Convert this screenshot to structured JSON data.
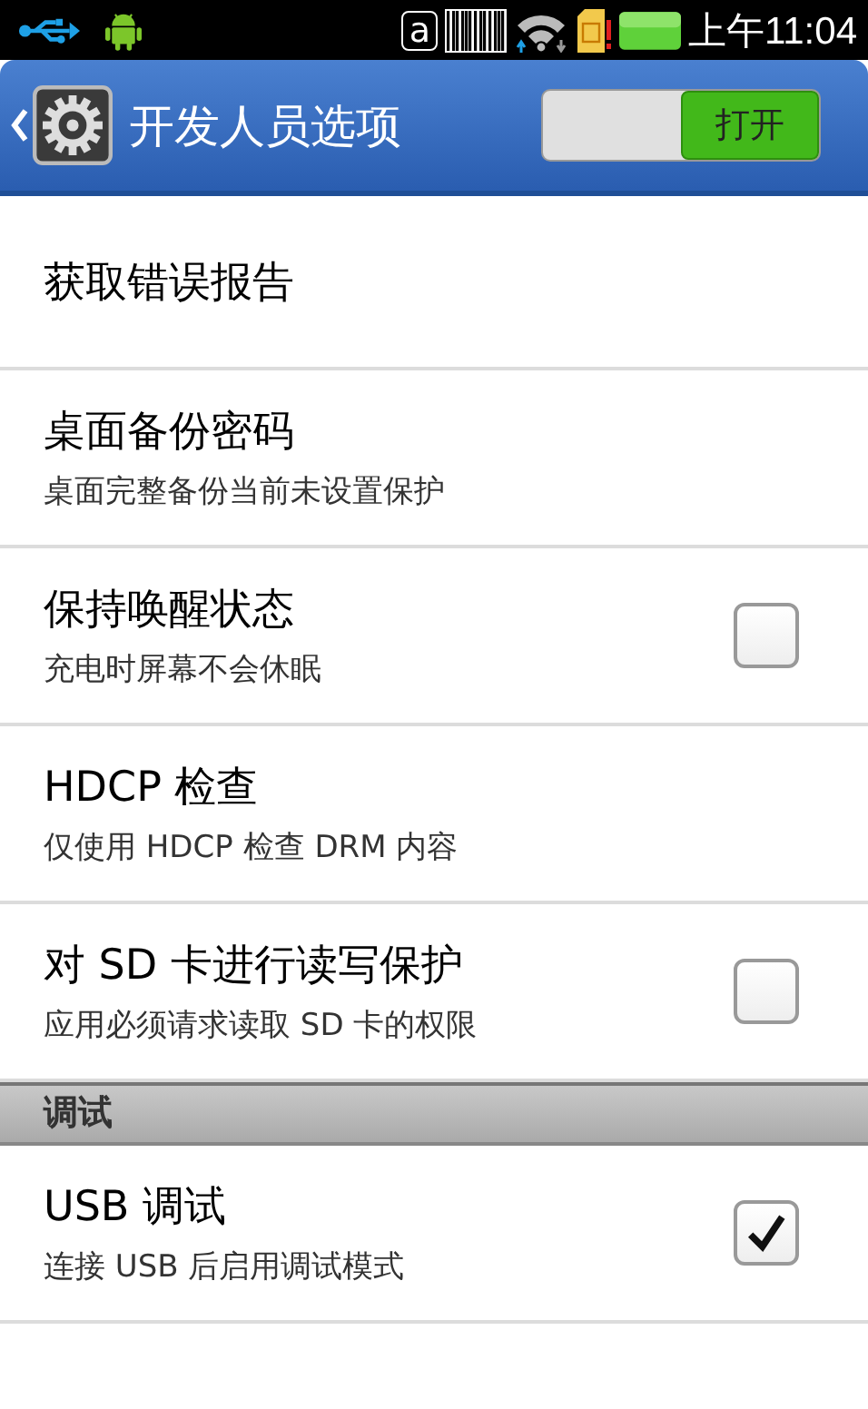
{
  "status_bar": {
    "badge": "a",
    "time": "上午11:04"
  },
  "header": {
    "title": "开发人员选项",
    "toggle": {
      "label": "打开",
      "on": true
    }
  },
  "items": [
    {
      "kind": "plain",
      "title": "获取错误报告"
    },
    {
      "kind": "plain",
      "title": "桌面备份密码",
      "summary": "桌面完整备份当前未设置保护"
    },
    {
      "kind": "checkbox",
      "title": "保持唤醒状态",
      "summary": "充电时屏幕不会休眠",
      "checked": false
    },
    {
      "kind": "plain",
      "title": "HDCP 检查",
      "summary": "仅使用 HDCP 检查 DRM 内容"
    },
    {
      "kind": "checkbox",
      "title": "对 SD 卡进行读写保护",
      "summary": "应用必须请求读取 SD 卡的权限",
      "checked": false
    },
    {
      "kind": "section",
      "title": "调试"
    },
    {
      "kind": "checkbox",
      "title": "USB 调试",
      "summary": "连接 USB 后启用调试模式",
      "checked": true
    }
  ]
}
